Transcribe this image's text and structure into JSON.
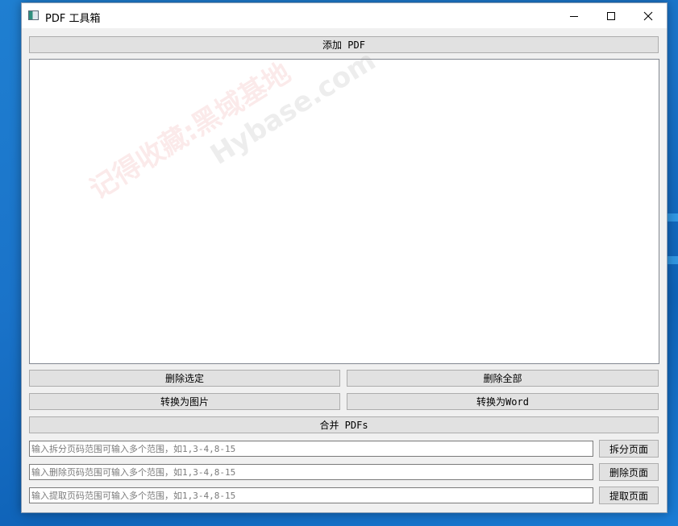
{
  "window": {
    "title": "PDF 工具箱"
  },
  "buttons": {
    "add_pdf": "添加 PDF",
    "delete_selected": "删除选定",
    "delete_all": "删除全部",
    "to_image": "转换为图片",
    "to_word": "转换为Word",
    "merge": "合并 PDFs",
    "split": "拆分页面",
    "delete_pages": "删除页面",
    "extract": "提取页面"
  },
  "inputs": {
    "split_placeholder": "输入拆分页码范围可输入多个范围，如1,3-4,8-15",
    "delete_placeholder": "输入删除页码范围可输入多个范围，如1,3-4,8-15",
    "extract_placeholder": "输入提取页码范围可输入多个范围，如1,3-4,8-15"
  },
  "pdf_list": {
    "items": []
  },
  "watermark": {
    "cn": "记得收藏:黑域基地",
    "en": "Hybase.com"
  },
  "colors": {
    "desktop": "#1a73c9",
    "button_face": "#e1e1e1",
    "window_bg": "#f0f0f0"
  }
}
